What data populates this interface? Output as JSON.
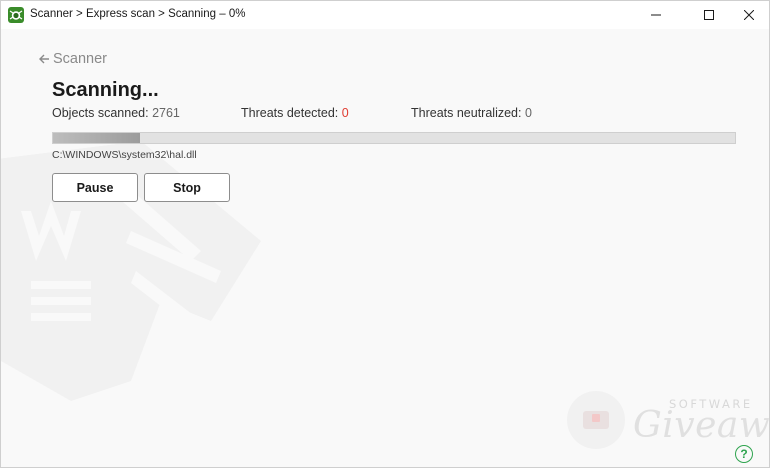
{
  "window": {
    "title": "Scanner > Express scan > Scanning – 0%"
  },
  "nav": {
    "back_label": "Scanner"
  },
  "main": {
    "title": "Scanning...",
    "stats": {
      "objects_label": "Objects scanned:",
      "objects_value": "2761",
      "threats_label": "Threats detected:",
      "threats_value": "0",
      "neutralized_label": "Threats neutralized:",
      "neutralized_value": "0"
    },
    "progress_fraction": 0.127,
    "current_file": "C:\\WINDOWS\\system32\\hal.dll",
    "buttons": {
      "pause": "Pause",
      "stop": "Stop"
    }
  },
  "watermark": {
    "software": "SOFTWARE",
    "giveaway": "Giveaway"
  },
  "help": {
    "label": "?"
  },
  "colors": {
    "threat_value": "#e03c31",
    "help_accent": "#2fa44f",
    "app_icon": "#3a8c2a"
  },
  "icons": {
    "app": "drweb-spider-icon",
    "minimize": "minimize-icon",
    "maximize": "maximize-icon",
    "close": "close-icon",
    "back": "arrow-left-icon",
    "help": "help-icon"
  }
}
